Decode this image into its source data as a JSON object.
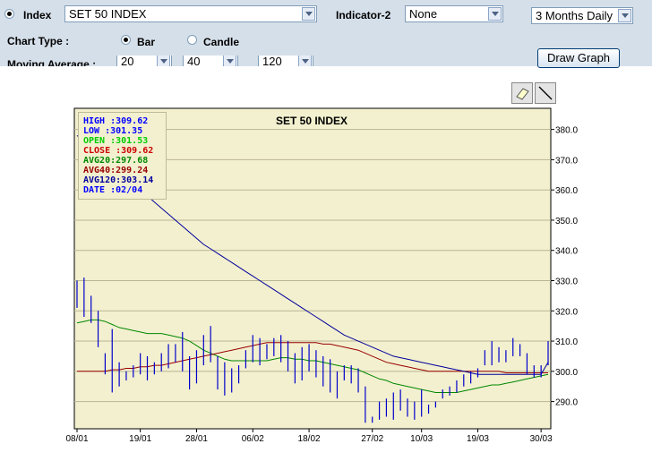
{
  "form": {
    "index_label": "Index",
    "index_value": "SET 50 INDEX",
    "indicator2_label": "Indicator-2",
    "indicator2_value": "None",
    "period_value": "3 Months Daily",
    "chart_type_label": "Chart Type :",
    "bar_label": "Bar",
    "candle_label": "Candle",
    "moving_average_label": "Moving Average :",
    "ma1_value": "20",
    "ma2_value": "40",
    "ma3_value": "120",
    "draw_button": "Draw Graph"
  },
  "info": {
    "high": "HIGH :309.62",
    "low": "LOW  :301.35",
    "open": "OPEN :301.53",
    "close": "CLOSE :309.62",
    "avg20": "AVG20:297.68",
    "avg40": "AVG40:299.24",
    "avg120": "AVG120:303.14",
    "date": "DATE :02/04"
  },
  "colors": {
    "plot_bg": "#f3f0cf",
    "price_bar": "#0000cc",
    "avg20": "#008800",
    "avg40": "#990000",
    "avg120": "#00009c",
    "high": "#0000ff",
    "open": "#00cc00",
    "close": "#cc0000"
  },
  "chart_data": {
    "type": "bar",
    "title": "SET 50 INDEX",
    "xlabel": "",
    "ylabel": "",
    "ylim": [
      281,
      387
    ],
    "y_ticks": [
      290,
      300,
      310,
      320,
      330,
      340,
      350,
      360,
      370,
      380
    ],
    "y_tick_labels": [
      "290.0",
      "300.0",
      "310.0",
      "320.0",
      "330.0",
      "340.0",
      "350.0",
      "360.0",
      "370.0",
      "380.0"
    ],
    "x_tick_labels": [
      "08/01",
      "19/01",
      "28/01",
      "06/02",
      "18/02",
      "27/02",
      "10/03",
      "19/03",
      "30/03"
    ],
    "x_tick_index": [
      0,
      9,
      17,
      25,
      33,
      42,
      49,
      57,
      66
    ],
    "grid": true,
    "bars_high": [
      330,
      331,
      325,
      320,
      306,
      314,
      303,
      300,
      302,
      306,
      305,
      303,
      306,
      309,
      309,
      313,
      305,
      307,
      312,
      315,
      305,
      303,
      301,
      302,
      307,
      312,
      311,
      309,
      311,
      312,
      310,
      306,
      308,
      309,
      307,
      305,
      304,
      300,
      302,
      302,
      301,
      295,
      285,
      290,
      291,
      293,
      294,
      291,
      290,
      294,
      289,
      288,
      294,
      295,
      297,
      299,
      300,
      301,
      307,
      310,
      308,
      307,
      311,
      309,
      306,
      302,
      302,
      310
    ],
    "bars_low": [
      321,
      318,
      316,
      308,
      299,
      293,
      295,
      297,
      298,
      299,
      297,
      299,
      300,
      301,
      303,
      300,
      294,
      296,
      302,
      303,
      294,
      292,
      293,
      296,
      301,
      303,
      302,
      304,
      305,
      303,
      300,
      296,
      297,
      300,
      298,
      295,
      293,
      291,
      297,
      296,
      293,
      283,
      283,
      284,
      285,
      284,
      287,
      285,
      284,
      285,
      286,
      290,
      291,
      292,
      293,
      295,
      296,
      298,
      302,
      302,
      303,
      303,
      305,
      305,
      299,
      298,
      298,
      302
    ],
    "series": [
      {
        "name": "AVG20",
        "values": [
          316,
          316.5,
          317,
          317,
          316.5,
          315.5,
          314.5,
          314,
          313.5,
          313,
          312.5,
          312.5,
          312.5,
          312,
          311.5,
          311,
          310,
          308.5,
          307,
          306,
          305,
          304,
          303.5,
          303.5,
          303.5,
          303.5,
          303.5,
          303.5,
          304,
          304.5,
          304.5,
          304,
          304,
          303.5,
          303.5,
          303,
          302.5,
          302,
          301.5,
          301,
          300.5,
          299.5,
          298.5,
          297.5,
          297,
          296,
          295.5,
          295,
          294.5,
          294,
          293.5,
          293,
          293,
          293,
          293,
          293.5,
          294,
          294.5,
          295,
          295.5,
          295.5,
          296,
          296.5,
          297,
          297.5,
          298,
          298.5,
          299
        ]
      },
      {
        "name": "AVG40",
        "values": [
          300,
          300,
          300,
          300,
          300,
          300.5,
          300.5,
          301,
          301,
          301.5,
          301.5,
          302,
          302,
          302.5,
          303,
          303.5,
          304,
          304.5,
          305,
          305.5,
          306,
          306.5,
          307,
          307.5,
          308,
          308.5,
          309,
          309.5,
          309.5,
          309.5,
          309.5,
          309.5,
          309.5,
          309.5,
          309.5,
          309,
          309,
          308.5,
          308,
          307.5,
          307,
          306,
          305,
          304,
          303,
          302.5,
          302,
          301.5,
          301,
          300.5,
          300,
          300,
          300,
          300,
          300,
          300,
          300,
          300,
          300,
          300,
          300,
          299.5,
          299.5,
          299.5,
          299.5,
          299.5,
          299.5,
          299.5
        ]
      },
      {
        "name": "AVG120",
        "values": [
          378,
          376,
          374,
          372,
          370,
          368,
          366,
          364,
          362,
          360,
          358,
          356,
          354,
          352,
          350,
          348,
          346,
          344,
          342,
          340.5,
          339,
          337.5,
          336,
          334.5,
          333,
          331.5,
          330,
          328.5,
          327,
          325.5,
          324,
          322.5,
          321,
          319.5,
          318,
          316.5,
          315,
          313.5,
          312,
          311,
          310,
          309,
          308,
          307,
          306,
          305,
          304.5,
          304,
          303.5,
          303,
          302.5,
          302,
          301.5,
          301,
          300.5,
          300,
          299.5,
          299,
          299,
          299,
          299,
          299,
          299,
          299,
          299,
          299,
          299,
          303
        ]
      }
    ]
  }
}
